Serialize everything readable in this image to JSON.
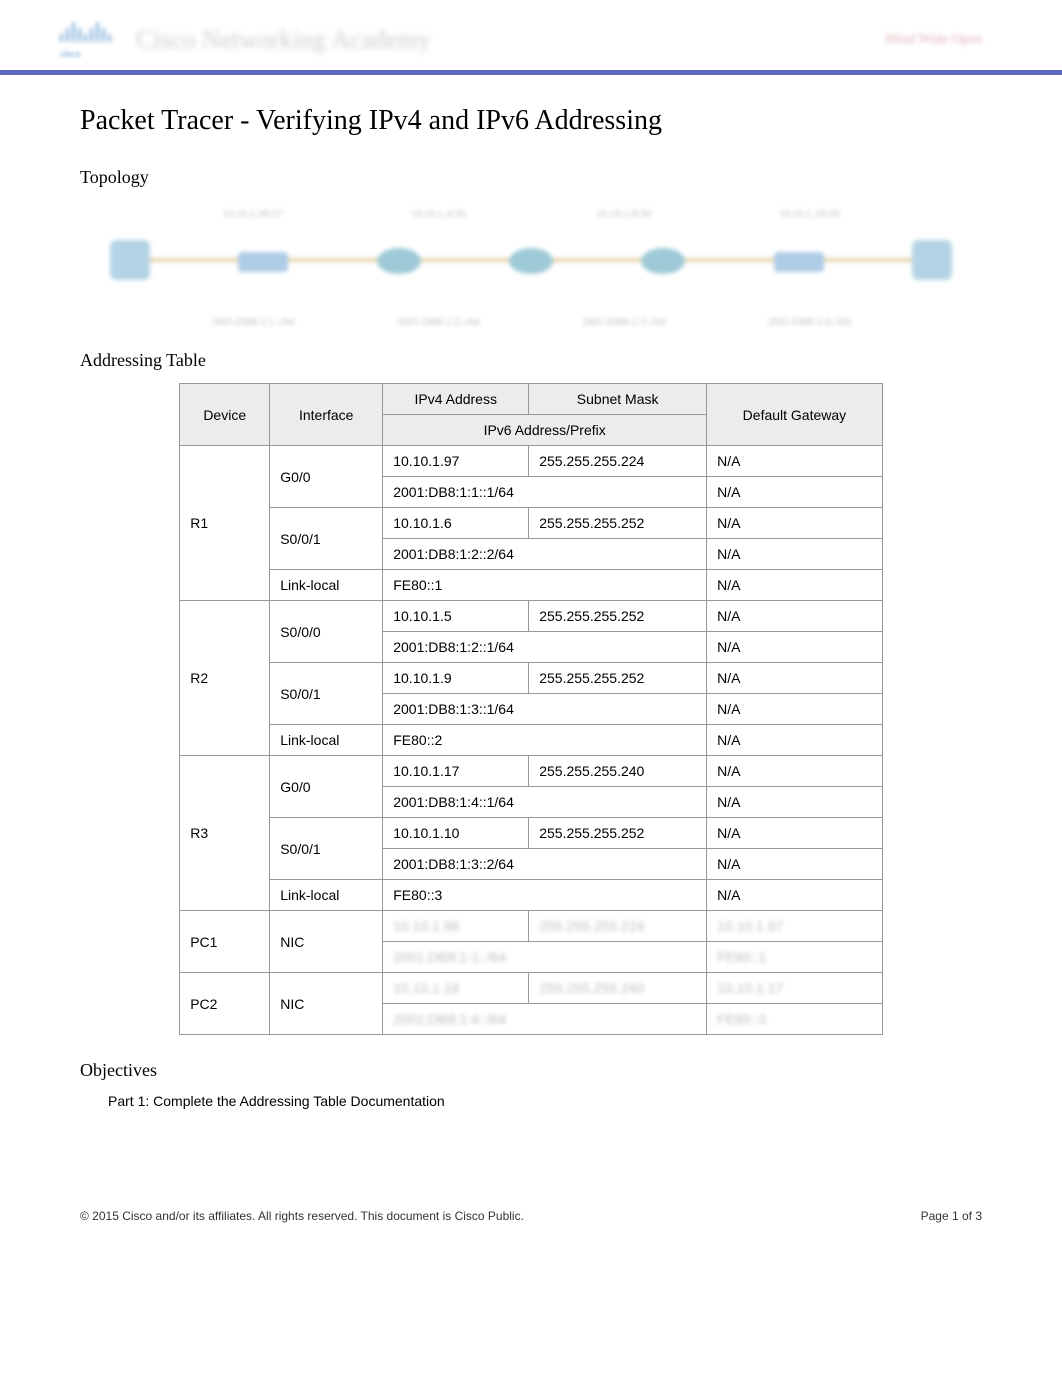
{
  "header": {
    "logo_word": "cisco",
    "title_blur": "Cisco Networking Academy",
    "right_blur": "Mind Wide Open"
  },
  "doc": {
    "title": "Packet Tracer - Verifying IPv4 and IPv6 Addressing",
    "section_topology": "Topology",
    "section_addressing": "Addressing Table",
    "section_objectives": "Objectives",
    "objective_part1": "Part 1: Complete the Addressing Table Documentation"
  },
  "topology": {
    "top_labels": [
      "10.10.1.96/27",
      "10.10.1.4/30",
      "10.10.1.8/30",
      "10.10.1.16/28"
    ],
    "bot_labels": [
      "2001:DB8:1:1::/64",
      "2001:DB8:1:2::/64",
      "2001:DB8:1:3::/64",
      "2001:DB8:1:4::/64"
    ]
  },
  "table": {
    "head": {
      "device": "Device",
      "interface": "Interface",
      "ipv4": "IPv4 Address",
      "mask": "Subnet Mask",
      "ipv6": "IPv6 Address/Prefix",
      "gateway": "Default Gateway"
    },
    "rows": [
      {
        "device": "R1",
        "interface": "G0/0",
        "ipv4": "10.10.1.97",
        "mask": "255.255.255.224",
        "gw": "N/A",
        "ipv6": "2001:DB8:1:1::1/64",
        "gw6": "N/A"
      },
      {
        "device": "",
        "interface": "S0/0/1",
        "ipv4": "10.10.1.6",
        "mask": "255.255.255.252",
        "gw": "N/A",
        "ipv6": "2001:DB8:1:2::2/64",
        "gw6": "N/A"
      },
      {
        "device": "",
        "interface": "Link-local",
        "ipv4": "FE80::1",
        "mask": "",
        "gw": "N/A",
        "ipv6": "",
        "gw6": ""
      },
      {
        "device": "R2",
        "interface": "S0/0/0",
        "ipv4": "10.10.1.5",
        "mask": "255.255.255.252",
        "gw": "N/A",
        "ipv6": "2001:DB8:1:2::1/64",
        "gw6": "N/A"
      },
      {
        "device": "",
        "interface": "S0/0/1",
        "ipv4": "10.10.1.9",
        "mask": "255.255.255.252",
        "gw": "N/A",
        "ipv6": "2001:DB8:1:3::1/64",
        "gw6": "N/A"
      },
      {
        "device": "",
        "interface": "Link-local",
        "ipv4": "FE80::2",
        "mask": "",
        "gw": "N/A",
        "ipv6": "",
        "gw6": ""
      },
      {
        "device": "R3",
        "interface": "G0/0",
        "ipv4": "10.10.1.17",
        "mask": "255.255.255.240",
        "gw": "N/A",
        "ipv6": "2001:DB8:1:4::1/64",
        "gw6": "N/A"
      },
      {
        "device": "",
        "interface": "S0/0/1",
        "ipv4": "10.10.1.10",
        "mask": "255.255.255.252",
        "gw": "N/A",
        "ipv6": "2001:DB8:1:3::2/64",
        "gw6": "N/A"
      },
      {
        "device": "",
        "interface": "Link-local",
        "ipv4": "FE80::3",
        "mask": "",
        "gw": "N/A",
        "ipv6": "",
        "gw6": ""
      },
      {
        "device": "PC1",
        "interface": "NIC",
        "ipv4_blur": "10.10.1.98",
        "mask_blur": "255.255.255.224",
        "gw_blur": "10.10.1.97",
        "ipv6_blur": "2001:DB8:1:1::/64",
        "gw6_blur": "FE80::1"
      },
      {
        "device": "PC2",
        "interface": "NIC",
        "ipv4_blur": "10.10.1.18",
        "mask_blur": "255.255.255.240",
        "gw_blur": "10.10.1.17",
        "ipv6_blur": "2001:DB8:1:4::/64",
        "gw6_blur": "FE80::3"
      }
    ]
  },
  "footer": {
    "copyright": "© 2015 Cisco and/or its affiliates. All rights reserved. This document is Cisco Public.",
    "page": "Page  1  of 3"
  }
}
